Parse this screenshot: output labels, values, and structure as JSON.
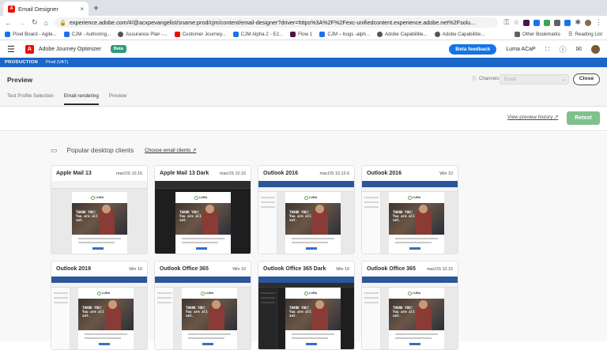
{
  "browser": {
    "tab_title": "Email Designer",
    "tab_close": "×",
    "new_tab": "+",
    "url": "experience.adobe.com/#/@acxpevangelist/sname:prod/cjm/content/email-designer?driver=https%3A%2F%2Fexc-unifiedcontent.experience.adobe.net%2Fsolu...",
    "bookmarks": [
      {
        "label": "Pixel Board - Agile...",
        "color": "#1a73e8"
      },
      {
        "label": "CJM - Authoring...",
        "color": "#1a73e8"
      },
      {
        "label": "Assurance Plan -...",
        "color": "#555555"
      },
      {
        "label": "Customer Journey...",
        "color": "#eb1000"
      },
      {
        "label": "CJM Alpha 2 - E2...",
        "color": "#1a73e8"
      },
      {
        "label": "Flow 1",
        "color": "#4a154b"
      },
      {
        "label": "CJM – bugs -alph...",
        "color": "#1a73e8"
      },
      {
        "label": "Adobe Capabilitie...",
        "color": "#555555"
      },
      {
        "label": "Adobe Capabilitie...",
        "color": "#555555"
      }
    ],
    "other_bookmarks": "Other Bookmarks",
    "reading_list": "Reading List"
  },
  "app": {
    "name": "Adobe Journey Optimizer",
    "beta_badge": "Beta",
    "beta_feedback": "Beta feedback",
    "org": "Luma ACaP",
    "env_label": "PRODUCTION",
    "env_name": "Prod (VA7)"
  },
  "preview": {
    "title": "Preview",
    "channels_label": "Channels",
    "channels_value": "Email",
    "close_label": "Close",
    "tabs": [
      "Test Profile Selection",
      "Email rendering",
      "Preview"
    ],
    "active_tab": 1,
    "history_link": "View preview history",
    "retest_label": "Retest"
  },
  "clients": {
    "section_title": "Popular desktop clients",
    "choose_link": "Choose email clients",
    "hero_text": "THANK YOU!\nYou are all\nset.",
    "logo_text": "LUMA",
    "cards": [
      {
        "name": "Apple Mail 13",
        "os": "macOS 10.15",
        "style": "mac"
      },
      {
        "name": "Apple Mail 13 Dark",
        "os": "macOS 10.15",
        "style": "macdark"
      },
      {
        "name": "Outlook 2016",
        "os": "macOS 10.12.6",
        "style": "outlook"
      },
      {
        "name": "Outlook 2016",
        "os": "Win 10",
        "style": "outlook"
      },
      {
        "name": "Outlook 2019",
        "os": "Win 10",
        "style": "outlook"
      },
      {
        "name": "Outlook Office 365",
        "os": "Win 10",
        "style": "outlook"
      },
      {
        "name": "Outlook Office 365 Dark",
        "os": "Win 10",
        "style": "outlookdark"
      },
      {
        "name": "Outlook Office 365",
        "os": "macOS 10.15",
        "style": "outlook"
      }
    ]
  }
}
